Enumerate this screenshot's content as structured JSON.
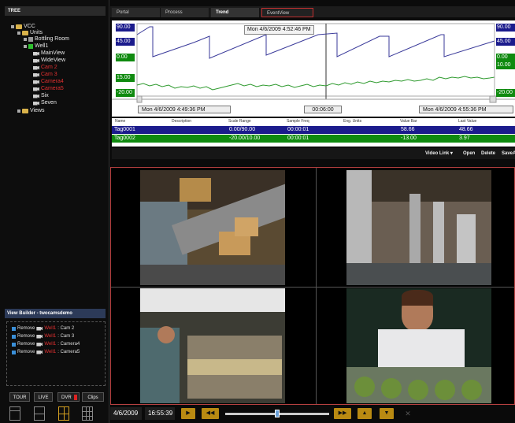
{
  "tree": {
    "header": "TREE",
    "nodes": [
      {
        "label": "VCC",
        "kind": "folder"
      },
      {
        "label": "Units",
        "kind": "folder"
      },
      {
        "label": "Bottling Room",
        "kind": "gray"
      },
      {
        "label": "Well1",
        "kind": "green"
      },
      {
        "label": "MainView",
        "kind": "cam"
      },
      {
        "label": "WideView",
        "kind": "cam"
      },
      {
        "label": "Cam 2",
        "kind": "cam-red"
      },
      {
        "label": "Cam 3",
        "kind": "cam-red"
      },
      {
        "label": "Camera4",
        "kind": "cam-red"
      },
      {
        "label": "Camera5",
        "kind": "cam-red"
      },
      {
        "label": "Six",
        "kind": "cam"
      },
      {
        "label": "Seven",
        "kind": "cam"
      },
      {
        "label": "Views",
        "kind": "folder"
      }
    ]
  },
  "view_builder": {
    "header": "View Builder - twocamsdemo",
    "items": [
      {
        "action": "Remove",
        "well": "Well1",
        "cam": ": Cam 2"
      },
      {
        "action": "Remove",
        "well": "Well1",
        "cam": ": Cam 3"
      },
      {
        "action": "Remove",
        "well": "Well1",
        "cam": ": Camera4"
      },
      {
        "action": "Remove",
        "well": "Well1",
        "cam": ": Camera5"
      }
    ],
    "buttons": {
      "tour": "TOUR",
      "live": "LIVE",
      "dvr": "DVR",
      "clips": "Clips"
    }
  },
  "tabs": [
    {
      "label": "Portal"
    },
    {
      "label": "Process"
    },
    {
      "label": "Trend"
    },
    {
      "label": "EventView"
    }
  ],
  "trend": {
    "timestamp": "Mon 4/6/2009  4:52:46 PM",
    "left_axis": [
      "90.00",
      "45.00",
      "0.00",
      "15.00",
      "-20.00"
    ],
    "right_axis": [
      "90.00",
      "45.00",
      "0.00",
      "10.00",
      "-20.00"
    ],
    "start_time": "Mon 4/6/2009  4:49:36 PM",
    "duration": "00:06:00",
    "end_time": "Mon 4/6/2009  4:55:36 PM",
    "colors": {
      "tag1": "#1b1b8c",
      "tag2": "#0f8a0f"
    }
  },
  "table": {
    "headers": [
      "Name",
      "Description",
      "Scale Range",
      "Sample Freq",
      "Eng. Units",
      "Value Bar",
      "Last Value"
    ],
    "rows": [
      {
        "name": "Tag0001",
        "desc": "",
        "range": "0.00/90.00",
        "freq": "00:00:01",
        "units": "",
        "bar": "58.66",
        "last": "48.66"
      },
      {
        "name": "Tag0002",
        "desc": "",
        "range": "-20.00/10.00",
        "freq": "00:00:01",
        "units": "",
        "bar": "-13.00",
        "last": "3.97"
      }
    ]
  },
  "video_toolbar": {
    "video_link": "Video Link",
    "open": "Open",
    "delete": "Delete",
    "save": "SaveA"
  },
  "playback": {
    "date": "4/6/2009",
    "time": "16:55:39",
    "position": 0.5
  }
}
